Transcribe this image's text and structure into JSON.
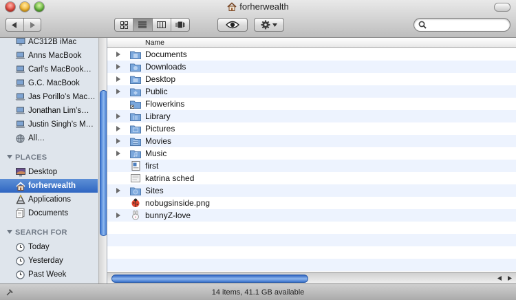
{
  "window": {
    "title": "forherwealth"
  },
  "toolbar": {
    "back_icon": "back-arrow-icon",
    "forward_icon": "forward-arrow-icon",
    "views": [
      "icon-view",
      "list-view",
      "column-view",
      "coverflow-view"
    ],
    "selected_view": "list-view",
    "search": {
      "value": "",
      "placeholder": ""
    }
  },
  "sidebar": {
    "devices": [
      {
        "label": "AC312B iMac",
        "icon": "imac-icon"
      },
      {
        "label": "Anns MacBook",
        "icon": "laptop-icon"
      },
      {
        "label": "Carl’s MacBook…",
        "icon": "laptop-icon"
      },
      {
        "label": "G.C. MacBook",
        "icon": "laptop-icon"
      },
      {
        "label": "Jas Porillo’s Mac…",
        "icon": "laptop-icon"
      },
      {
        "label": "Jonathan Lim’s…",
        "icon": "laptop-icon"
      },
      {
        "label": "Justin Singh’s M…",
        "icon": "laptop-icon"
      },
      {
        "label": "All…",
        "icon": "network-globe-icon"
      }
    ],
    "places_header": "PLACES",
    "places": [
      {
        "label": "Desktop",
        "icon": "desktop-icon",
        "selected": false
      },
      {
        "label": "forherwealth",
        "icon": "home-icon",
        "selected": true
      },
      {
        "label": "Applications",
        "icon": "applications-icon",
        "selected": false
      },
      {
        "label": "Documents",
        "icon": "documents-icon",
        "selected": false
      }
    ],
    "search_header": "SEARCH FOR",
    "searches": [
      {
        "label": "Today",
        "icon": "clock-icon"
      },
      {
        "label": "Yesterday",
        "icon": "clock-icon"
      },
      {
        "label": "Past Week",
        "icon": "clock-icon"
      }
    ]
  },
  "list": {
    "column_header": "Name",
    "items": [
      {
        "name": "Documents",
        "kind": "folder",
        "expandable": true
      },
      {
        "name": "Downloads",
        "kind": "folder",
        "expandable": true
      },
      {
        "name": "Desktop",
        "kind": "folder",
        "expandable": true
      },
      {
        "name": "Public",
        "kind": "folder",
        "expandable": true
      },
      {
        "name": "Flowerkins",
        "kind": "alias-folder",
        "expandable": false
      },
      {
        "name": "Library",
        "kind": "folder",
        "expandable": true
      },
      {
        "name": "Pictures",
        "kind": "folder",
        "expandable": true
      },
      {
        "name": "Movies",
        "kind": "folder",
        "expandable": true
      },
      {
        "name": "Music",
        "kind": "folder",
        "expandable": true
      },
      {
        "name": "first",
        "kind": "document",
        "expandable": false
      },
      {
        "name": "katrina sched",
        "kind": "text-file",
        "expandable": false
      },
      {
        "name": "Sites",
        "kind": "folder",
        "expandable": true
      },
      {
        "name": "nobugsinside.png",
        "kind": "image",
        "expandable": false
      },
      {
        "name": "bunnyZ-love",
        "kind": "package",
        "expandable": true
      }
    ]
  },
  "status": {
    "text": "14 items, 41.1 GB available"
  },
  "colors": {
    "selection": "#3a6fc8",
    "sidebar": "#dfe5ec",
    "stripe": "#edf3fe",
    "folder": "#7aa7dc"
  }
}
